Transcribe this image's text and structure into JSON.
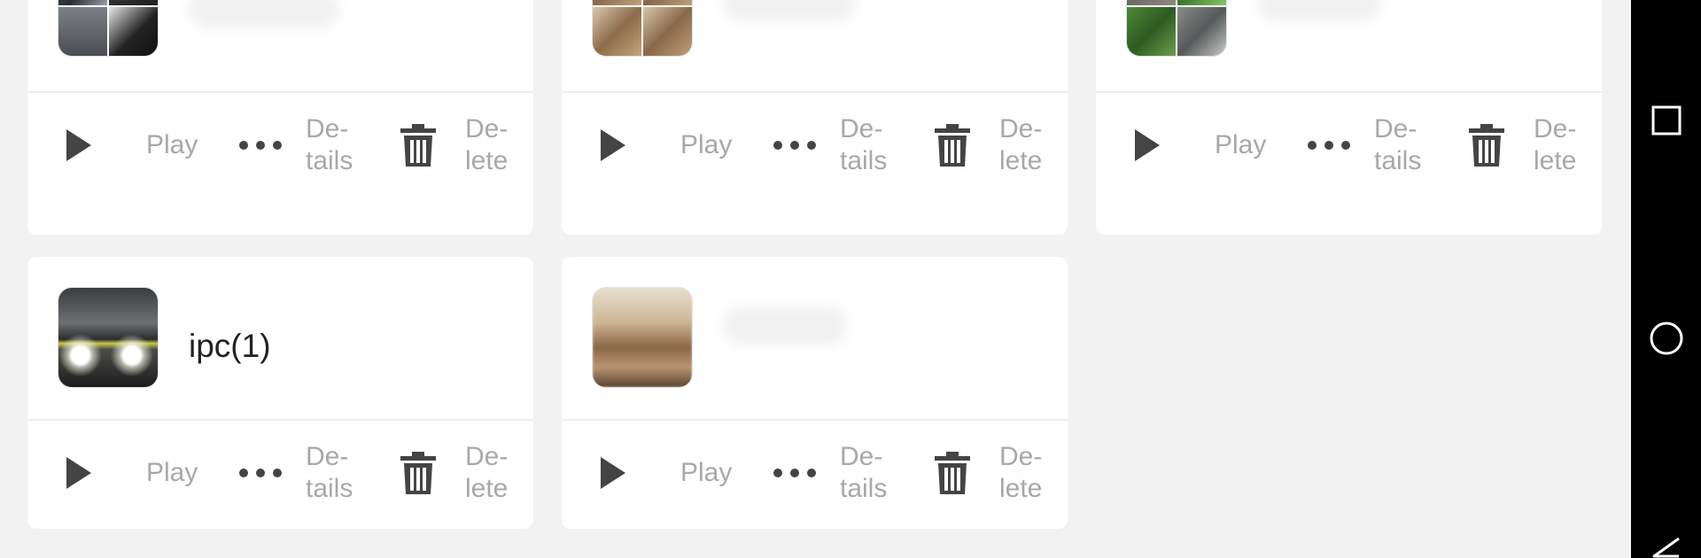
{
  "actions": {
    "play": "Play",
    "details": "De-\ntails",
    "delete": "De-\nlete"
  },
  "cards": [
    {
      "name": "",
      "thumbnail": "night-street-grid",
      "name_visible": false
    },
    {
      "name": "",
      "thumbnail": "office-grid",
      "name_visible": false
    },
    {
      "name": "",
      "thumbnail": "garden-grid",
      "name_visible": false
    },
    {
      "name": "ipc(1)",
      "thumbnail": "car-headlights",
      "name_visible": true
    },
    {
      "name": "",
      "thumbnail": "office-single",
      "name_visible": false
    }
  ],
  "navbar": {
    "buttons": [
      "recents-square-icon",
      "home-circle-icon",
      "back-triangle-icon"
    ]
  },
  "colors": {
    "card": "#ffffff",
    "background": "#f2f2f2",
    "icon": "#444444",
    "label": "#a8a8a8",
    "navbar": "#000000"
  }
}
